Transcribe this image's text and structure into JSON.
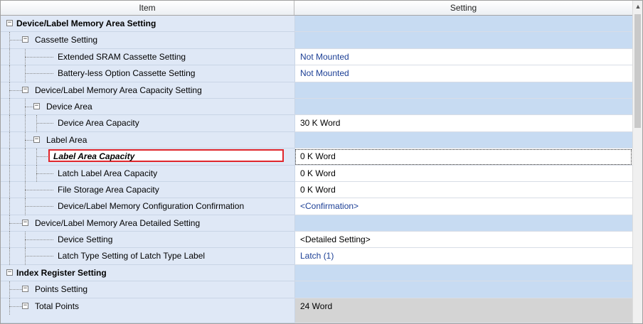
{
  "header": {
    "item_label": "Item",
    "setting_label": "Setting"
  },
  "rows": [
    {
      "id": "device-label-memory-area-setting",
      "label": "Device/Label Memory Area Setting",
      "level": 0,
      "expandable": true,
      "bold": true,
      "setting": "",
      "kind": "group"
    },
    {
      "id": "cassette-setting",
      "label": "Cassette Setting",
      "level": 1,
      "expandable": true,
      "setting": "",
      "kind": "group"
    },
    {
      "id": "extended-sram-cassette-setting",
      "label": "Extended SRAM Cassette Setting",
      "level": 2,
      "setting": "Not Mounted",
      "kind": "value",
      "link": true
    },
    {
      "id": "battery-less-option-cassette-setting",
      "label": "Battery-less Option Cassette Setting",
      "level": 2,
      "setting": "Not Mounted",
      "kind": "value",
      "link": true
    },
    {
      "id": "device-label-memory-area-capacity-setting",
      "label": "Device/Label Memory Area Capacity Setting",
      "level": 1,
      "expandable": true,
      "setting": "",
      "kind": "group"
    },
    {
      "id": "device-area",
      "label": "Device Area",
      "level": 2,
      "expandable": true,
      "setting": "",
      "kind": "group"
    },
    {
      "id": "device-area-capacity",
      "label": "Device Area Capacity",
      "level": 3,
      "setting": "30 K Word",
      "kind": "value"
    },
    {
      "id": "label-area",
      "label": "Label Area",
      "level": 2,
      "expandable": true,
      "setting": "",
      "kind": "group"
    },
    {
      "id": "label-area-capacity",
      "label": "Label Area Capacity",
      "level": 3,
      "setting": "0 K Word",
      "kind": "value",
      "highlighted": true
    },
    {
      "id": "latch-label-area-capacity",
      "label": "Latch Label Area Capacity",
      "level": 3,
      "setting": "0 K Word",
      "kind": "value"
    },
    {
      "id": "file-storage-area-capacity",
      "label": "File Storage Area Capacity",
      "level": 2,
      "setting": "0 K Word",
      "kind": "value"
    },
    {
      "id": "device-label-memory-configuration-confirmation",
      "label": "Device/Label Memory Configuration Confirmation",
      "level": 2,
      "setting": "<Confirmation>",
      "kind": "value",
      "link": true
    },
    {
      "id": "device-label-memory-area-detailed-setting",
      "label": "Device/Label Memory Area Detailed Setting",
      "level": 1,
      "expandable": true,
      "setting": "",
      "kind": "group"
    },
    {
      "id": "device-setting",
      "label": "Device Setting",
      "level": 2,
      "setting": "<Detailed Setting>",
      "kind": "value"
    },
    {
      "id": "latch-type-setting-of-latch-type-label",
      "label": "Latch Type Setting of Latch Type Label",
      "level": 2,
      "setting": "Latch (1)",
      "kind": "value",
      "link": true
    },
    {
      "id": "index-register-setting",
      "label": "Index Register Setting",
      "level": 0,
      "expandable": true,
      "bold": true,
      "setting": "",
      "kind": "group"
    },
    {
      "id": "points-setting",
      "label": "Points Setting",
      "level": 1,
      "expandable": true,
      "setting": "",
      "kind": "group"
    },
    {
      "id": "total-points",
      "label": "Total Points",
      "level": 1,
      "expandable": true,
      "setting": "24 Word",
      "kind": "gray",
      "partial": true
    }
  ],
  "icons": {
    "expand_toggle": "minus-box-icon",
    "scroll_up": "chevron-up-icon"
  },
  "colors": {
    "item_column_bg": "#dfe8f6",
    "group_setting_bg": "#c7dbf2",
    "link_text": "#1c3f95",
    "highlight_border": "#e0262c",
    "disabled_setting_bg": "#d4d4d4"
  }
}
